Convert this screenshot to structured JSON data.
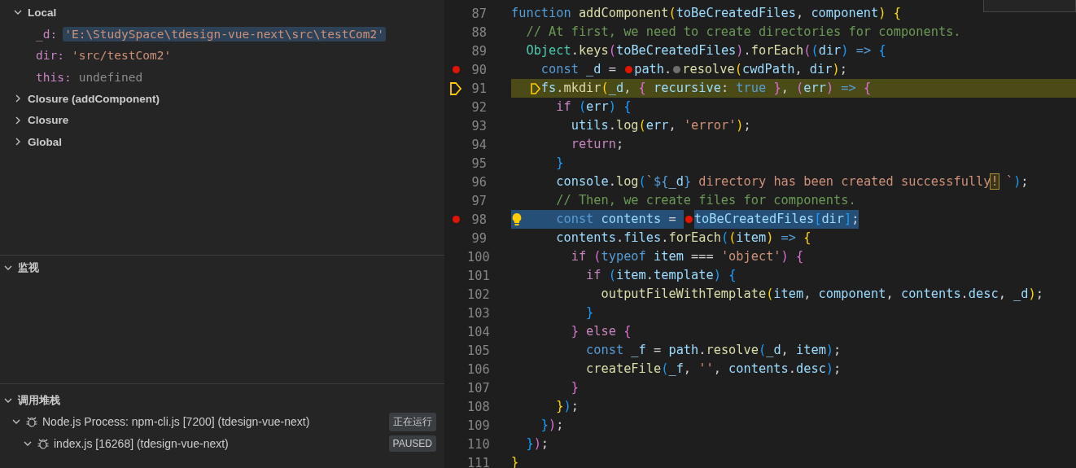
{
  "variables": {
    "scopes": [
      {
        "label": "Local",
        "expanded": true,
        "children": [
          {
            "name": "_d:",
            "value": "'E:\\StudySpace\\tdesign-vue-next\\src\\testCom2'",
            "kind": "string",
            "selected": true
          },
          {
            "name": "dir:",
            "value": "'src/testCom2'",
            "kind": "string",
            "selected": false
          },
          {
            "name": "this:",
            "value": "undefined",
            "kind": "undefined",
            "selected": false
          }
        ]
      },
      {
        "label": "Closure (addComponent)",
        "expanded": false
      },
      {
        "label": "Closure",
        "expanded": false
      },
      {
        "label": "Global",
        "expanded": false
      }
    ]
  },
  "watch": {
    "title": "监视",
    "expanded": true
  },
  "call_stack": {
    "title": "调用堆栈",
    "expanded": true,
    "sessions": [
      {
        "label": "Node.js Process: npm-cli.js [7200] (tdesign-vue-next)",
        "badge": "正在运行",
        "expanded": true,
        "children": [
          {
            "label": "index.js [16268] (tdesign-vue-next)",
            "badge": "PAUSED",
            "expanded": true
          }
        ]
      }
    ]
  },
  "editor": {
    "lines": [
      {
        "n": "87",
        "breakpoint": false,
        "current": false,
        "selected": false,
        "tokens": [
          {
            "kind": "kw",
            "text": "function "
          },
          {
            "kind": "fn",
            "text": "addComponent"
          },
          {
            "kind": "b1",
            "text": "("
          },
          {
            "kind": "var",
            "text": "toBeCreatedFiles"
          },
          {
            "kind": "p",
            "text": ", "
          },
          {
            "kind": "var",
            "text": "component"
          },
          {
            "kind": "b1",
            "text": ") "
          },
          {
            "kind": "b1",
            "text": "{"
          }
        ]
      },
      {
        "n": "88",
        "breakpoint": false,
        "current": false,
        "selected": false,
        "tokens": [
          {
            "kind": "cm",
            "text": "  // At first, we need to create directories for components."
          }
        ]
      },
      {
        "n": "89",
        "breakpoint": false,
        "current": false,
        "selected": false,
        "tokens": [
          {
            "kind": "cls",
            "text": "  Object"
          },
          {
            "kind": "p",
            "text": "."
          },
          {
            "kind": "fn",
            "text": "keys"
          },
          {
            "kind": "b2",
            "text": "("
          },
          {
            "kind": "var",
            "text": "toBeCreatedFiles"
          },
          {
            "kind": "b2",
            "text": ")"
          },
          {
            "kind": "p",
            "text": "."
          },
          {
            "kind": "fn",
            "text": "forEach"
          },
          {
            "kind": "b2",
            "text": "("
          },
          {
            "kind": "b3",
            "text": "("
          },
          {
            "kind": "var",
            "text": "dir"
          },
          {
            "kind": "b3",
            "text": ") "
          },
          {
            "kind": "kw",
            "text": "=> "
          },
          {
            "kind": "b3",
            "text": "{"
          }
        ]
      },
      {
        "n": "90",
        "breakpoint": true,
        "current": false,
        "selected": false,
        "tokens": [
          {
            "kind": "kw",
            "text": "    const "
          },
          {
            "kind": "var",
            "text": "_d "
          },
          {
            "kind": "p",
            "text": "= "
          },
          {
            "kind": "bp"
          },
          {
            "kind": "var",
            "text": "path"
          },
          {
            "kind": "p",
            "text": "."
          },
          {
            "kind": "bpg"
          },
          {
            "kind": "fn",
            "text": "resolve"
          },
          {
            "kind": "b1",
            "text": "("
          },
          {
            "kind": "var",
            "text": "cwdPath"
          },
          {
            "kind": "p",
            "text": ", "
          },
          {
            "kind": "var",
            "text": "dir"
          },
          {
            "kind": "b1",
            "text": ")"
          },
          {
            "kind": "p",
            "text": ";"
          }
        ]
      },
      {
        "n": "91",
        "breakpoint": false,
        "current": true,
        "selected": false,
        "tokens": [
          {
            "kind": "var",
            "text": "    fs"
          },
          {
            "kind": "p",
            "text": "."
          },
          {
            "kind": "fn",
            "text": "mkdir"
          },
          {
            "kind": "b1",
            "text": "("
          },
          {
            "kind": "var",
            "text": "_d"
          },
          {
            "kind": "p",
            "text": ", "
          },
          {
            "kind": "b2",
            "text": "{ "
          },
          {
            "kind": "var",
            "text": "recursive"
          },
          {
            "kind": "p",
            "text": ": "
          },
          {
            "kind": "kw",
            "text": "true "
          },
          {
            "kind": "b2",
            "text": "}"
          },
          {
            "kind": "p",
            "text": ", "
          },
          {
            "kind": "b2",
            "text": "("
          },
          {
            "kind": "var",
            "text": "err"
          },
          {
            "kind": "b2",
            "text": ") "
          },
          {
            "kind": "kw",
            "text": "=> "
          },
          {
            "kind": "b2",
            "text": "{"
          }
        ]
      },
      {
        "n": "92",
        "breakpoint": false,
        "current": false,
        "selected": false,
        "tokens": [
          {
            "kind": "ctl",
            "text": "      if "
          },
          {
            "kind": "b3",
            "text": "("
          },
          {
            "kind": "var",
            "text": "err"
          },
          {
            "kind": "b3",
            "text": ") "
          },
          {
            "kind": "b3",
            "text": "{"
          }
        ]
      },
      {
        "n": "93",
        "breakpoint": false,
        "current": false,
        "selected": false,
        "tokens": [
          {
            "kind": "var",
            "text": "        utils"
          },
          {
            "kind": "p",
            "text": "."
          },
          {
            "kind": "fn",
            "text": "log"
          },
          {
            "kind": "b1",
            "text": "("
          },
          {
            "kind": "var",
            "text": "err"
          },
          {
            "kind": "p",
            "text": ", "
          },
          {
            "kind": "str",
            "text": "'error'"
          },
          {
            "kind": "b1",
            "text": ")"
          },
          {
            "kind": "p",
            "text": ";"
          }
        ]
      },
      {
        "n": "94",
        "breakpoint": false,
        "current": false,
        "selected": false,
        "tokens": [
          {
            "kind": "ctl",
            "text": "        return"
          },
          {
            "kind": "p",
            "text": ";"
          }
        ]
      },
      {
        "n": "95",
        "breakpoint": false,
        "current": false,
        "selected": false,
        "tokens": [
          {
            "kind": "b3",
            "text": "      }"
          }
        ]
      },
      {
        "n": "96",
        "breakpoint": false,
        "current": false,
        "selected": false,
        "tokens": [
          {
            "kind": "var",
            "text": "      console"
          },
          {
            "kind": "p",
            "text": "."
          },
          {
            "kind": "fn",
            "text": "log"
          },
          {
            "kind": "b3",
            "text": "("
          },
          {
            "kind": "str",
            "text": "`"
          },
          {
            "kind": "kw",
            "text": "${"
          },
          {
            "kind": "var",
            "text": "_d"
          },
          {
            "kind": "kw",
            "text": "}"
          },
          {
            "kind": "str",
            "text": " directory has been created successfully"
          },
          {
            "kind": "match",
            "text": "!"
          },
          {
            "kind": "str",
            "text": " `"
          },
          {
            "kind": "b3",
            "text": ")"
          },
          {
            "kind": "p",
            "text": ";"
          }
        ]
      },
      {
        "n": "97",
        "breakpoint": false,
        "current": false,
        "selected": false,
        "tokens": [
          {
            "kind": "cm",
            "text": "      // Then, we create files for components."
          }
        ]
      },
      {
        "n": "98",
        "breakpoint": true,
        "current": false,
        "selected": true,
        "tokens": [
          {
            "kind": "kw",
            "text": "      const "
          },
          {
            "kind": "var",
            "text": "contents "
          },
          {
            "kind": "p",
            "text": "= "
          },
          {
            "kind": "bp"
          },
          {
            "kind": "var",
            "text": "toBeCreatedFiles"
          },
          {
            "kind": "b3",
            "text": "["
          },
          {
            "kind": "var",
            "text": "dir"
          },
          {
            "kind": "b3",
            "text": "]"
          },
          {
            "kind": "p",
            "text": ";"
          }
        ]
      },
      {
        "n": "99",
        "breakpoint": false,
        "current": false,
        "selected": false,
        "tokens": [
          {
            "kind": "var",
            "text": "      contents"
          },
          {
            "kind": "p",
            "text": "."
          },
          {
            "kind": "var",
            "text": "files"
          },
          {
            "kind": "p",
            "text": "."
          },
          {
            "kind": "fn",
            "text": "forEach"
          },
          {
            "kind": "b3",
            "text": "("
          },
          {
            "kind": "b1",
            "text": "("
          },
          {
            "kind": "var",
            "text": "item"
          },
          {
            "kind": "b1",
            "text": ") "
          },
          {
            "kind": "kw",
            "text": "=> "
          },
          {
            "kind": "b1",
            "text": "{"
          }
        ]
      },
      {
        "n": "100",
        "breakpoint": false,
        "current": false,
        "selected": false,
        "tokens": [
          {
            "kind": "ctl",
            "text": "        if "
          },
          {
            "kind": "b2",
            "text": "("
          },
          {
            "kind": "kw",
            "text": "typeof "
          },
          {
            "kind": "var",
            "text": "item "
          },
          {
            "kind": "p",
            "text": "=== "
          },
          {
            "kind": "str",
            "text": "'object'"
          },
          {
            "kind": "b2",
            "text": ") "
          },
          {
            "kind": "b2",
            "text": "{"
          }
        ]
      },
      {
        "n": "101",
        "breakpoint": false,
        "current": false,
        "selected": false,
        "tokens": [
          {
            "kind": "ctl",
            "text": "          if "
          },
          {
            "kind": "b3",
            "text": "("
          },
          {
            "kind": "var",
            "text": "item"
          },
          {
            "kind": "p",
            "text": "."
          },
          {
            "kind": "var",
            "text": "template"
          },
          {
            "kind": "b3",
            "text": ") "
          },
          {
            "kind": "b3",
            "text": "{"
          }
        ]
      },
      {
        "n": "102",
        "breakpoint": false,
        "current": false,
        "selected": false,
        "tokens": [
          {
            "kind": "fn",
            "text": "            outputFileWithTemplate"
          },
          {
            "kind": "b1",
            "text": "("
          },
          {
            "kind": "var",
            "text": "item"
          },
          {
            "kind": "p",
            "text": ", "
          },
          {
            "kind": "var",
            "text": "component"
          },
          {
            "kind": "p",
            "text": ", "
          },
          {
            "kind": "var",
            "text": "contents"
          },
          {
            "kind": "p",
            "text": "."
          },
          {
            "kind": "var",
            "text": "desc"
          },
          {
            "kind": "p",
            "text": ", "
          },
          {
            "kind": "var",
            "text": "_d"
          },
          {
            "kind": "b1",
            "text": ")"
          },
          {
            "kind": "p",
            "text": ";"
          }
        ]
      },
      {
        "n": "103",
        "breakpoint": false,
        "current": false,
        "selected": false,
        "tokens": [
          {
            "kind": "b3",
            "text": "          }"
          }
        ]
      },
      {
        "n": "104",
        "breakpoint": false,
        "current": false,
        "selected": false,
        "tokens": [
          {
            "kind": "b2",
            "text": "        } "
          },
          {
            "kind": "ctl",
            "text": "else "
          },
          {
            "kind": "b2",
            "text": "{"
          }
        ]
      },
      {
        "n": "105",
        "breakpoint": false,
        "current": false,
        "selected": false,
        "tokens": [
          {
            "kind": "kw",
            "text": "          const "
          },
          {
            "kind": "var",
            "text": "_f "
          },
          {
            "kind": "p",
            "text": "= "
          },
          {
            "kind": "var",
            "text": "path"
          },
          {
            "kind": "p",
            "text": "."
          },
          {
            "kind": "fn",
            "text": "resolve"
          },
          {
            "kind": "b3",
            "text": "("
          },
          {
            "kind": "var",
            "text": "_d"
          },
          {
            "kind": "p",
            "text": ", "
          },
          {
            "kind": "var",
            "text": "item"
          },
          {
            "kind": "b3",
            "text": ")"
          },
          {
            "kind": "p",
            "text": ";"
          }
        ]
      },
      {
        "n": "106",
        "breakpoint": false,
        "current": false,
        "selected": false,
        "tokens": [
          {
            "kind": "fn",
            "text": "          createFile"
          },
          {
            "kind": "b3",
            "text": "("
          },
          {
            "kind": "var",
            "text": "_f"
          },
          {
            "kind": "p",
            "text": ", "
          },
          {
            "kind": "str",
            "text": "''"
          },
          {
            "kind": "p",
            "text": ", "
          },
          {
            "kind": "var",
            "text": "contents"
          },
          {
            "kind": "p",
            "text": "."
          },
          {
            "kind": "var",
            "text": "desc"
          },
          {
            "kind": "b3",
            "text": ")"
          },
          {
            "kind": "p",
            "text": ";"
          }
        ]
      },
      {
        "n": "107",
        "breakpoint": false,
        "current": false,
        "selected": false,
        "tokens": [
          {
            "kind": "b2",
            "text": "        }"
          }
        ]
      },
      {
        "n": "108",
        "breakpoint": false,
        "current": false,
        "selected": false,
        "tokens": [
          {
            "kind": "b1",
            "text": "      }"
          },
          {
            "kind": "b3",
            "text": ")"
          },
          {
            "kind": "p",
            "text": ";"
          }
        ]
      },
      {
        "n": "109",
        "breakpoint": false,
        "current": false,
        "selected": false,
        "tokens": [
          {
            "kind": "b3",
            "text": "    }"
          },
          {
            "kind": "b2",
            "text": ")"
          },
          {
            "kind": "p",
            "text": ";"
          }
        ]
      },
      {
        "n": "110",
        "breakpoint": false,
        "current": false,
        "selected": false,
        "tokens": [
          {
            "kind": "b3",
            "text": "  }"
          },
          {
            "kind": "b2",
            "text": ")"
          },
          {
            "kind": "p",
            "text": ";"
          }
        ]
      },
      {
        "n": "111",
        "breakpoint": false,
        "current": false,
        "selected": false,
        "tokens": [
          {
            "kind": "b1",
            "text": "}"
          }
        ]
      }
    ]
  }
}
